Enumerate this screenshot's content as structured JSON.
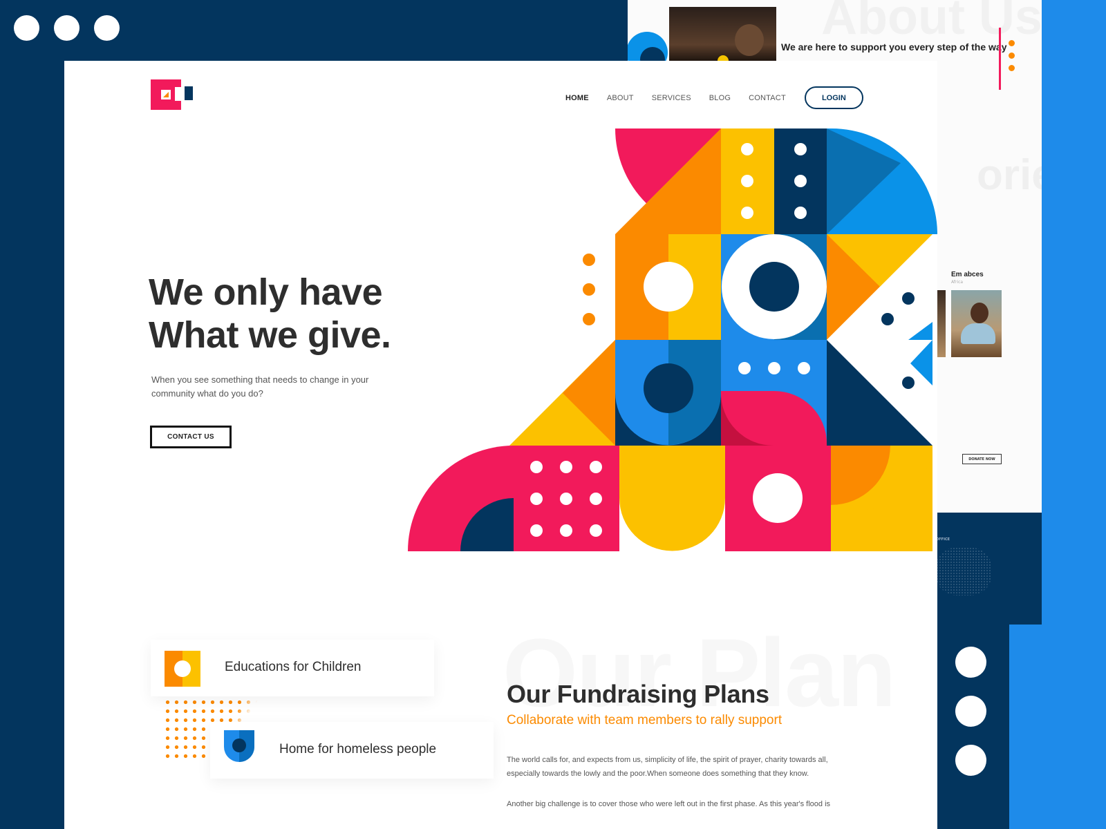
{
  "colors": {
    "navy": "#03355e",
    "blue": "#1e8bea",
    "pink": "#f21a5b",
    "orange": "#fb8a00",
    "yellow": "#fcc100",
    "text": "#2e2e2e"
  },
  "header": {
    "nav": [
      "HOME",
      "ABOUT",
      "SERVICES",
      "BLOG",
      "CONTACT"
    ],
    "active_nav": "HOME",
    "login_label": "LOGIN"
  },
  "hero": {
    "title_line1": "We only have",
    "title_line2": "What we give.",
    "subtitle": "When you see something that needs to change in your community what do you do?",
    "cta_label": "CONTACT US"
  },
  "services": {
    "card1_label": "Educations for Children",
    "card2_label": "Home for homeless people"
  },
  "plans": {
    "ghost_text": "Our Plan",
    "title": "Our Fundraising Plans",
    "subtitle": "Collaborate with team members to rally support",
    "paragraph1": "The world calls for, and expects from us, simplicity of life, the spirit of prayer, charity towards all, especially towards the lowly and the poor.When someone does something that they know.",
    "paragraph2": "Another big challenge is to cover those who were left out in the first phase. As this year's flood is"
  },
  "background_page": {
    "ghost_about": "About Us",
    "ghost_stories": "ories",
    "support_title": "We are here to support you every step of the way",
    "story_name": "Em abces",
    "story_location": "Africa",
    "donate_label": "DONATE NOW",
    "footer_label": "OFFICE"
  }
}
